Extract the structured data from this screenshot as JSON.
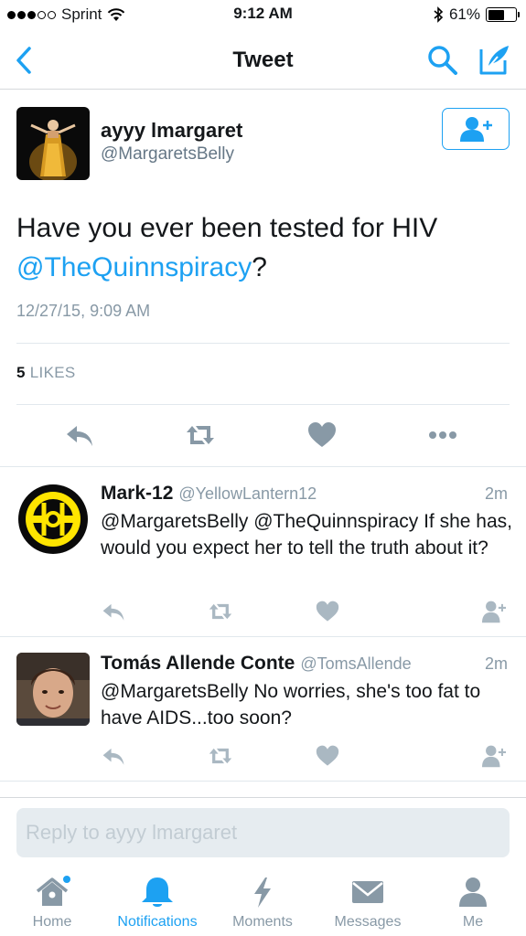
{
  "status_bar": {
    "carrier": "Sprint",
    "time": "9:12 AM",
    "battery": "61%",
    "battery_level": 0.61
  },
  "nav": {
    "title": "Tweet"
  },
  "tweet": {
    "author_name": "ayyy lmargaret",
    "author_handle": "@MargaretsBelly",
    "text_plain": "Have you ever been tested for HIV ",
    "text_mention": "@TheQuinnspiracy",
    "text_suffix": "?",
    "timestamp": "12/27/15, 9:09 AM",
    "likes_count": "5",
    "likes_label": "LIKES"
  },
  "replies": [
    {
      "name": "Mark-12",
      "handle": "@YellowLantern12",
      "time": "2m",
      "text": "@MargaretsBelly @TheQuinnspiracy If she has, would you expect her to tell the truth about it?"
    },
    {
      "name": "Tomás Allende Conte",
      "handle": "@TomsAllende",
      "time": "2m",
      "text": "@MargaretsBelly No worries, she's too fat to have AIDS...too soon?"
    }
  ],
  "reply_bar": {
    "placeholder": "Reply to ayyy lmargaret"
  },
  "tabs": [
    {
      "label": "Home",
      "icon": "home-icon"
    },
    {
      "label": "Notifications",
      "icon": "bell-icon",
      "active": true
    },
    {
      "label": "Moments",
      "icon": "lightning-icon"
    },
    {
      "label": "Messages",
      "icon": "envelope-icon"
    },
    {
      "label": "Me",
      "icon": "person-icon"
    }
  ],
  "colors": {
    "accent": "#1da1f2",
    "muted": "#8899a6",
    "icon_gray": "#aab8c2"
  }
}
